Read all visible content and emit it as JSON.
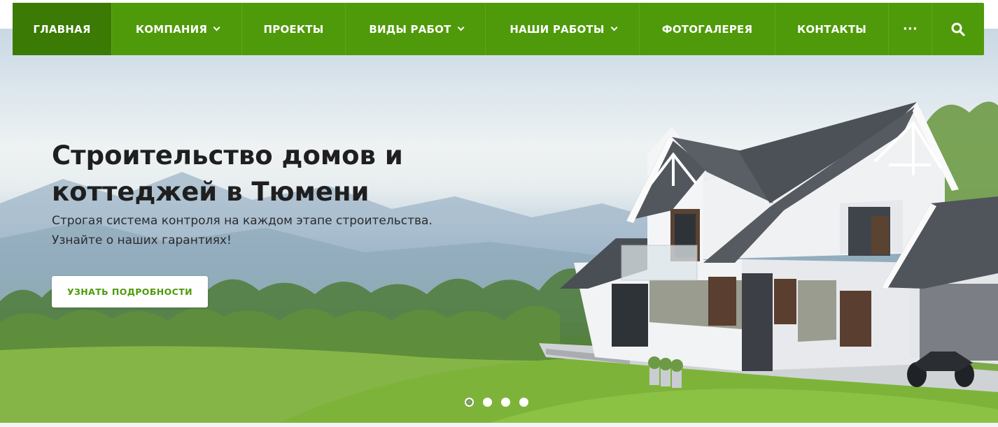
{
  "nav": {
    "items": [
      {
        "label": "ГЛАВНАЯ",
        "active": true,
        "dropdown": false
      },
      {
        "label": "КОМПАНИЯ",
        "active": false,
        "dropdown": true
      },
      {
        "label": "ПРОЕКТЫ",
        "active": false,
        "dropdown": false
      },
      {
        "label": "ВИДЫ РАБОТ",
        "active": false,
        "dropdown": true
      },
      {
        "label": "НАШИ РАБОТЫ",
        "active": false,
        "dropdown": true
      },
      {
        "label": "ФОТОГАЛЕРЕЯ",
        "active": false,
        "dropdown": false
      },
      {
        "label": "КОНТАКТЫ",
        "active": false,
        "dropdown": false
      }
    ],
    "more_label": "···",
    "search_icon": "search-icon",
    "brand_color": "#4f9a0a",
    "active_color": "#3b7a05"
  },
  "hero": {
    "title_line1": "Строительство домов и",
    "title_line2": "коттеджей в Тюмени",
    "subtitle_line1": "Строгая система контроля на каждом этапе строительства.",
    "subtitle_line2": "Узнайте о наших гарантиях!",
    "button_label": "УЗНАТЬ ПОДРОБНОСТИ"
  },
  "slider": {
    "slide_count": 4,
    "active_slide": 1
  }
}
